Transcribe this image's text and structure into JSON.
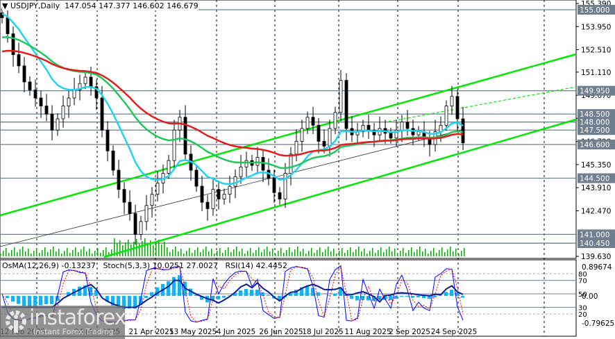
{
  "header": {
    "symbol": "USDJPY",
    "timeframe": "Daily",
    "ohlc": "147.054 147.377 146.602 146.679"
  },
  "indicator_header": {
    "osma": "OsMA(12,26,9) -0.13237",
    "stoch": "Stoch(5,3,3) 10.0251 27.0027",
    "rsi": "RSI(14) 42.4452"
  },
  "watermark": {
    "brand": "instaforex",
    "tagline": "Instant Forex Trading"
  },
  "colors": {
    "candle": "#000000",
    "ma_fast": "#22d3ee",
    "ma_mid": "#22c55e",
    "ma_slow": "#e11d1d",
    "channel": "#00e600",
    "volume": "#10a010",
    "osma": "#1ab0e8",
    "stoch_main": "#0000ff",
    "stoch_signal": "#ff0000",
    "rsi": "#0a1f8f",
    "level_line": "#6f7f8f",
    "level_label_bg": "#6f7f8f"
  },
  "chart_data": {
    "type": "line",
    "title": "USDJPY Daily",
    "ylim": [
      139.63,
      155.39
    ],
    "y_ticks": [
      "155.390",
      "153.950",
      "152.510",
      "151.110",
      "149.670",
      "148.230",
      "146.790",
      "145.350",
      "143.910",
      "142.470",
      "139.630"
    ],
    "x_ticks": [
      "12 Feb 2025",
      "24 Mar 2025",
      "21 Apr 2025",
      "13 May 2025",
      "4 Jun 2025",
      "26 Jun 2025",
      "18 Jul 2025",
      "11 Aug 2025",
      "2 Sep 2025",
      "24 Sep 2025"
    ],
    "levels": [
      155.0,
      149.95,
      148.5,
      148.0,
      147.5,
      146.6,
      144.5,
      141.0,
      140.45
    ],
    "level_labels": [
      "155.000",
      "149.950",
      "148.500",
      "148.000",
      "147.500",
      "146.600",
      "144.500",
      "141.000",
      "140.450"
    ],
    "closes": [
      154.5,
      153.5,
      152.2,
      151.5,
      150.5,
      150.0,
      149.5,
      149.0,
      148.5,
      147.5,
      148.2,
      149.0,
      149.5,
      150.0,
      150.4,
      150.8,
      150.2,
      149.5,
      147.5,
      146.2,
      145.0,
      143.8,
      143.0,
      142.3,
      141.0,
      141.8,
      142.8,
      143.5,
      144.2,
      144.8,
      145.6,
      147.5,
      148.3,
      146.0,
      145.0,
      144.0,
      143.0,
      142.6,
      143.8,
      143.2,
      143.5,
      144.0,
      144.6,
      145.2,
      145.6,
      145.3,
      145.8,
      145.0,
      144.5,
      143.6,
      143.2,
      144.8,
      146.0,
      146.8,
      147.6,
      148.3,
      147.8,
      146.8,
      146.5,
      147.6,
      148.6,
      150.6,
      147.6,
      147.2,
      147.4,
      147.8,
      147.5,
      147.2,
      147.6,
      147.3,
      147.0,
      147.5,
      148.0,
      147.6,
      147.2,
      147.4,
      147.0,
      146.6,
      147.4,
      147.8,
      149.0,
      149.6,
      148.2,
      146.7
    ],
    "indicator": {
      "ylim": [
        -0.79625,
        0.89674
      ],
      "y_ticks": [
        "0.89674",
        "0.00",
        "-0.79625"
      ],
      "stoch_levels": [
        "80",
        "70",
        "50",
        "30",
        "20"
      ]
    }
  }
}
